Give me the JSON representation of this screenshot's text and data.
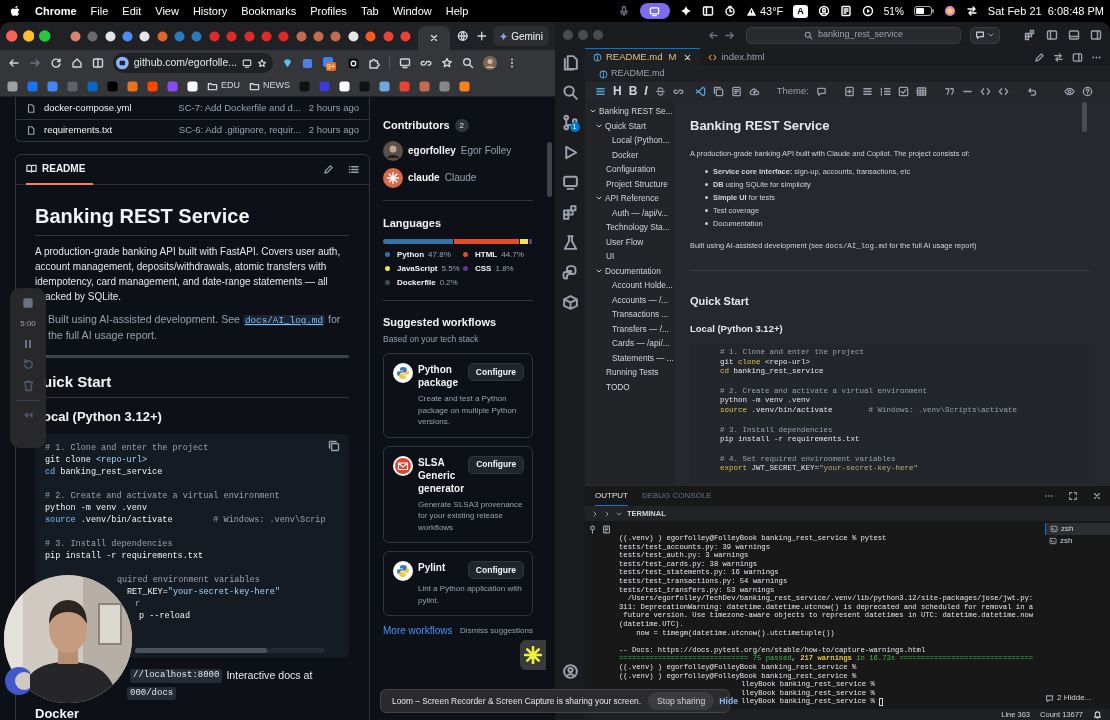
{
  "menu_bar": {
    "app": "Chrome",
    "menus": [
      "File",
      "Edit",
      "View",
      "History",
      "Bookmarks",
      "Profiles",
      "Tab",
      "Window",
      "Help"
    ],
    "weather": "43°F",
    "keyboard": "A",
    "battery": "51%",
    "clock": "Sat Feb 21  6:08:48 PM"
  },
  "browser": {
    "gemini": "Gemini",
    "address": "github.com/egorfolle...",
    "badge": "9+",
    "bookmark_folders": [
      "EDU",
      "NEWS"
    ]
  },
  "files": [
    {
      "name": "docker-compose.yml",
      "commit": "SC-7: Add Dockerfile and d...",
      "time": "2 hours ago"
    },
    {
      "name": "requirements.txt",
      "commit": "SC-6: Add .gitignore, requir...",
      "time": "2 hours ago"
    }
  ],
  "readme": {
    "tab": "README",
    "title": "Banking REST Service",
    "intro": "A production-grade banking API built with FastAPI. Covers user auth, account management, deposits/withdrawals, atomic transfers with idempotency, card management, and date-range statements — all",
    "intro_tail": "acked by SQLite.",
    "note": "Built using AI-assisted development. See",
    "note_link": "docs/AI_log.md",
    "note_end": "for the full AI usage report.",
    "h2": "uick Start",
    "h3": "ocal (Python 3.12+)",
    "code": [
      {
        "kind": "line",
        "parts": [
          {
            "kind": "comment",
            "text": "# 1. Clone and enter the project"
          }
        ]
      },
      {
        "kind": "line",
        "parts": [
          {
            "kind": "plain",
            "text": "git clone "
          },
          {
            "kind": "string",
            "text": "<repo-url>"
          }
        ]
      },
      {
        "kind": "line",
        "parts": [
          {
            "kind": "keyword",
            "text": "cd"
          },
          {
            "kind": "plain",
            "text": " banking_rest_service"
          }
        ]
      },
      {
        "kind": "blank"
      },
      {
        "kind": "line",
        "parts": [
          {
            "kind": "comment",
            "text": "# 2. Create and activate a virtual environment"
          }
        ]
      },
      {
        "kind": "line",
        "parts": [
          {
            "kind": "plain",
            "text": "python -m venv .venv"
          }
        ]
      },
      {
        "kind": "line",
        "parts": [
          {
            "kind": "keyword",
            "text": "source"
          },
          {
            "kind": "plain",
            "text": " .venv/bin/activate        "
          },
          {
            "kind": "comment",
            "text": "# Windows: .venv\\Scrip"
          }
        ]
      },
      {
        "kind": "blank"
      },
      {
        "kind": "line",
        "parts": [
          {
            "kind": "comment",
            "text": "# 3. Install dependencies"
          }
        ]
      },
      {
        "kind": "line",
        "parts": [
          {
            "kind": "plain",
            "text": "pip install -r requirements.txt"
          }
        ]
      },
      {
        "kind": "blank"
      },
      {
        "kind": "covered",
        "parts": [
          {
            "kind": "comment",
            "text": "quired environment variables"
          }
        ]
      },
      {
        "kind": "covered",
        "parts": [
          {
            "kind": "plain",
            "text": "RET_KEY="
          },
          {
            "kind": "string",
            "text": "\"your-secret-key-here\""
          }
        ]
      },
      {
        "kind": "covered",
        "parts": [
          {
            "kind": "comment",
            "text": "r"
          }
        ]
      },
      {
        "kind": "covered",
        "parts": [
          {
            "kind": "plain",
            "text": "p --reload"
          }
        ]
      }
    ],
    "after_code": "//localhost:8000",
    "after_text": "Interactive docs at",
    "after_code_2": "000/docs",
    "next_heading": "Docker"
  },
  "contributors": {
    "title": "Contributors",
    "count": "2",
    "people": [
      {
        "login": "egorfolley",
        "name": "Egor Folley"
      },
      {
        "kind": "starburst",
        "login": "claude",
        "name": "Claude"
      }
    ]
  },
  "languages": {
    "title": "Languages",
    "items": [
      {
        "name": "Python",
        "percent": "47.8%",
        "color": "#3572a5"
      },
      {
        "name": "HTML",
        "percent": "44.7%",
        "color": "#e34c26"
      },
      {
        "name": "JavaScript",
        "percent": "5.5%",
        "color": "#f1e05a"
      },
      {
        "name": "CSS",
        "percent": "1.8%",
        "color": "#663399"
      },
      {
        "name": "Dockerfile",
        "percent": "0.2%",
        "color": "#384d54"
      }
    ]
  },
  "workflows": {
    "title": "Suggested workflows",
    "subtitle": "Based on your tech stack",
    "items": [
      {
        "kind": "python",
        "name": "Python package",
        "button": "Configure",
        "description": "Create and test a Python package on multiple Python versions."
      },
      {
        "kind": "envelope",
        "name": "SLSA Generic generator",
        "button": "Configure",
        "description": "Generate SLSA3 provenance for your existing release workflows"
      },
      {
        "kind": "python",
        "name": "Pylint",
        "button": "Configure",
        "description": "Lint a Python application with pylint."
      }
    ],
    "more": "More workflows",
    "dismiss": "Dismiss suggestions"
  },
  "loom": {
    "time": "5:00",
    "banner": "Loom – Screen Recorder & Screen Capture is sharing your screen.",
    "stop": "Stop sharing",
    "hide": "Hide"
  },
  "editor": {
    "search": "banking_rest_service",
    "scm_badge": "1",
    "tabs": [
      {
        "label": "README.md",
        "modified": "M",
        "selected": true
      },
      {
        "label": "index.html",
        "selected": false
      }
    ],
    "breadcrumb": "README.md",
    "toolbar_letters": [
      "H",
      "B",
      "I"
    ],
    "theme_label": "Theme:",
    "outline": [
      {
        "label": "Banking REST Se...",
        "expanded": true,
        "children": [
          {
            "label": "Quick Start",
            "expanded": true,
            "children": [
              {
                "label": "Local (Python..."
              },
              {
                "label": "Docker"
              }
            ]
          },
          {
            "label": "Configuration"
          },
          {
            "label": "Project Structure"
          },
          {
            "label": "API Reference",
            "expanded": true,
            "children": [
              {
                "label": "Auth — /api/v..."
              }
            ]
          },
          {
            "label": "Technology Sta..."
          },
          {
            "label": "User Flow"
          },
          {
            "label": "UI"
          },
          {
            "label": "Documentation",
            "expanded": true,
            "children": [
              {
                "label": "Account Holde..."
              },
              {
                "label": "Accounts — /..."
              },
              {
                "label": "Transactions ..."
              },
              {
                "label": "Transfers — /..."
              },
              {
                "label": "Cards — /api/..."
              },
              {
                "label": "Statements — ..."
              }
            ]
          },
          {
            "label": "Running Tests"
          },
          {
            "label": "TODO"
          }
        ]
      }
    ]
  },
  "preview": {
    "title": "Banking REST Service",
    "intro": "A production-grade banking API built with Claude and Copilot. The project consists of:",
    "bullets": [
      "**Service core interface:** sign-up, accounts, transactions, etc",
      "**DB** using SQLite for simplicity",
      "**Simple UI** for tests",
      "Test coverage",
      "Documentation"
    ],
    "note": "Built using AI-assisted development (see",
    "note_code": "docs/AI_log.md",
    "note_end": "for the full AI usage report)",
    "h2": "Quick Start",
    "h3": "Local (Python 3.12+)",
    "code": [
      {
        "kind": "line",
        "parts": [
          {
            "kind": "comment",
            "text": "# 1. Clone and enter the project"
          }
        ]
      },
      {
        "kind": "line",
        "parts": [
          {
            "kind": "plain",
            "text": "git "
          },
          {
            "kind": "keyword",
            "text": "clone"
          },
          {
            "kind": "plain",
            "text": " <repo-url>"
          }
        ]
      },
      {
        "kind": "line",
        "parts": [
          {
            "kind": "keyword",
            "text": "cd"
          },
          {
            "kind": "plain",
            "text": " banking_rest_service"
          }
        ]
      },
      {
        "kind": "blank"
      },
      {
        "kind": "line",
        "parts": [
          {
            "kind": "comment",
            "text": "# 2. Create and activate a virtual environment"
          }
        ]
      },
      {
        "kind": "line",
        "parts": [
          {
            "kind": "plain",
            "text": "python -m venv .venv"
          }
        ]
      },
      {
        "kind": "line",
        "parts": [
          {
            "kind": "keyword",
            "text": "source"
          },
          {
            "kind": "plain",
            "text": " .venv/bin/activate        "
          },
          {
            "kind": "comment",
            "text": "# Windows: .venv\\Scripts\\activate"
          }
        ]
      },
      {
        "kind": "blank"
      },
      {
        "kind": "line",
        "parts": [
          {
            "kind": "comment",
            "text": "# 3. Install dependencies"
          }
        ]
      },
      {
        "kind": "line",
        "parts": [
          {
            "kind": "plain",
            "text": "pip install -r requirements.txt"
          }
        ]
      },
      {
        "kind": "blank"
      },
      {
        "kind": "line",
        "parts": [
          {
            "kind": "comment",
            "text": "# 4. Set required environment variables"
          }
        ]
      },
      {
        "kind": "line",
        "parts": [
          {
            "kind": "keyword",
            "text": "export"
          },
          {
            "kind": "plain",
            "text": " JWT_SECRET_KEY="
          },
          {
            "kind": "string",
            "text": "\"your-secret-key-here\""
          }
        ]
      }
    ]
  },
  "panel": {
    "tabs": [
      {
        "label": "OUTPUT",
        "selected": true
      },
      {
        "label": "DEBUG CONSOLE",
        "selected": false
      }
    ],
    "section": "TERMINAL",
    "terminal": [
      {
        "kind": "line",
        "parts": [
          {
            "kind": "plain",
            "text": "((.venv) ) egorfolley@FolleyBook banking_rest_service % pytest"
          }
        ]
      },
      {
        "kind": "line",
        "parts": [
          {
            "kind": "plain",
            "text": "tests/test_accounts.py: 39 warnings"
          }
        ]
      },
      {
        "kind": "line",
        "parts": [
          {
            "kind": "plain",
            "text": "tests/test_auth.py: 3 warnings"
          }
        ]
      },
      {
        "kind": "line",
        "parts": [
          {
            "kind": "plain",
            "text": "tests/test_cards.py: 38 warnings"
          }
        ]
      },
      {
        "kind": "line",
        "parts": [
          {
            "kind": "plain",
            "text": "tests/test_statements.py: 16 warnings"
          }
        ]
      },
      {
        "kind": "line",
        "parts": [
          {
            "kind": "plain",
            "text": "tests/test_transactions.py: 54 warnings"
          }
        ]
      },
      {
        "kind": "line",
        "parts": [
          {
            "kind": "plain",
            "text": "tests/test_transfers.py: 53 warnings"
          }
        ]
      },
      {
        "kind": "line",
        "parts": [
          {
            "kind": "plain",
            "text": "  /Users/egorfolley/TechDev/banking_rest_service/.venv/lib/python3.12/site-packages/jose/jwt.py:"
          }
        ]
      },
      {
        "kind": "line",
        "parts": [
          {
            "kind": "plain",
            "text": "311: DeprecationWarning: datetime.datetime.utcnow() is deprecated and scheduled for removal in a"
          }
        ]
      },
      {
        "kind": "line",
        "parts": [
          {
            "kind": "plain",
            "text": " future version. Use timezone-aware objects to represent datetimes in UTC: datetime.datetime.now"
          }
        ]
      },
      {
        "kind": "line",
        "parts": [
          {
            "kind": "plain",
            "text": "(datetime.UTC)."
          }
        ]
      },
      {
        "kind": "line",
        "parts": [
          {
            "kind": "plain",
            "text": "    now = timegm(datetime.utcnow().utctimetuple())"
          }
        ]
      },
      {
        "kind": "blank"
      },
      {
        "kind": "line",
        "parts": [
          {
            "kind": "plain",
            "text": "-- Docs: https://docs.pytest.org/en/stable/how-to/capture-warnings.html"
          }
        ]
      },
      {
        "kind": "line",
        "parts": [
          {
            "kind": "pass",
            "text": "============================== 75 passed"
          },
          {
            "kind": "plain",
            "text": ", "
          },
          {
            "kind": "warn",
            "text": "217 warnings"
          },
          {
            "kind": "pass",
            "text": " in 16.73s ==============================="
          }
        ]
      },
      {
        "kind": "line",
        "parts": [
          {
            "kind": "plain",
            "text": "((.venv) ) egorfolley@FolleyBook banking_rest_service %"
          }
        ]
      },
      {
        "kind": "line",
        "parts": [
          {
            "kind": "plain",
            "text": "((.venv) ) egorfolley@FolleyBook banking_rest_service %"
          }
        ]
      },
      {
        "kind": "covered",
        "parts": [
          {
            "kind": "plain",
            "text": "lleyBook banking_rest_service %"
          }
        ]
      },
      {
        "kind": "covered",
        "parts": [
          {
            "kind": "plain",
            "text": "lleyBook banking_rest_service %"
          }
        ]
      },
      {
        "kind": "covered",
        "cursor": true,
        "parts": [
          {
            "kind": "plain",
            "text": "lleyBook banking_rest_service %"
          }
        ]
      }
    ],
    "sessions": [
      {
        "label": "zsh",
        "selected": true
      },
      {
        "label": "zsh",
        "selected": false
      }
    ],
    "hidden": "2 Hidde..."
  },
  "status_bar": {
    "line": "Line 363",
    "count": "Count 13677"
  }
}
